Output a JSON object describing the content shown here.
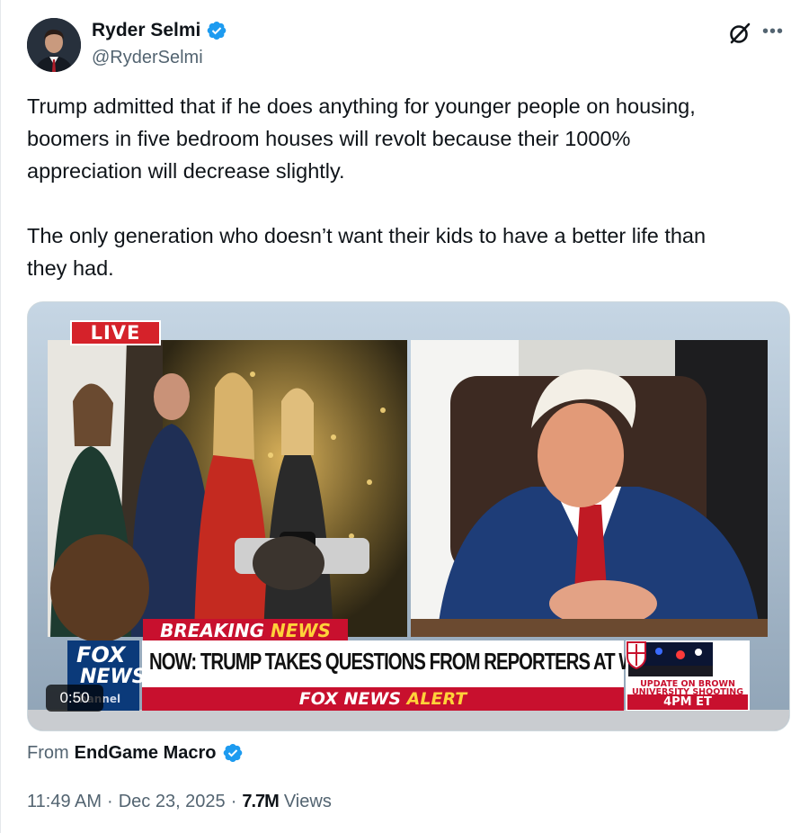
{
  "author": {
    "display_name": "Ryder Selmi",
    "handle": "@RyderSelmi",
    "verified": true
  },
  "tweet": {
    "paragraphs": [
      "Trump admitted that if he does anything for younger people on housing,\nboomers in five bedroom houses will revolt because their 1000%\nappreciation will decrease slightly.",
      "The only generation who doesn’t want their kids to have a better life than\nthey had."
    ]
  },
  "media": {
    "live_label": "LIVE",
    "breaking_prefix": "BREAKING",
    "breaking_suffix": "NEWS",
    "headline": "NOW: TRUMP TAKES QUESTIONS FROM REPORTERS AT WH",
    "alert_brand": "FOX NEWS",
    "alert_word": "ALERT",
    "logo_line1": "FOX",
    "logo_line2": "NEWS",
    "logo_line3": "channel",
    "side_update_line1": "UPDATE ON BROWN",
    "side_update_line2": "UNIVERSITY SHOOTING",
    "side_update_time": "4PM ET",
    "duration": "0:50"
  },
  "source": {
    "prefix": "From",
    "name": "EndGame Macro",
    "verified": true
  },
  "meta": {
    "time": "11:49 AM",
    "date": "Dec 23, 2025",
    "views_count": "7.7M",
    "views_label": "Views"
  },
  "colors": {
    "verified_blue": "#1d9bf0",
    "fox_red": "#c8102e",
    "fox_blue": "#0b3a7a",
    "muted_text": "#536471"
  },
  "icons": [
    "verified-badge-icon",
    "grok-icon",
    "more-options-icon"
  ]
}
